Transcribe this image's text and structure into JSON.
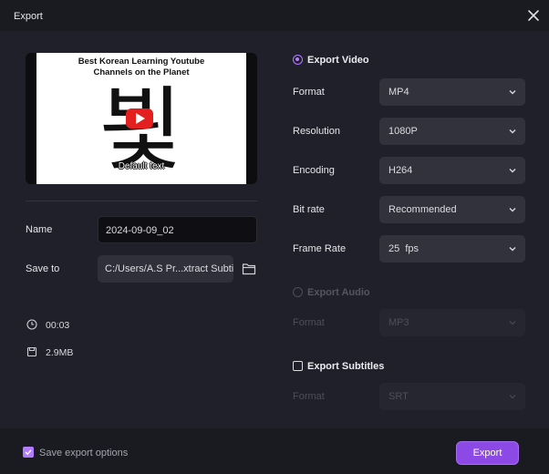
{
  "window": {
    "title": "Export"
  },
  "preview": {
    "thumbnail_title_line1": "Best Korean Learning Youtube",
    "thumbnail_title_line2": "Channels on the Planet",
    "thumbnail_character": "뵟",
    "subtitle_text": "Default text"
  },
  "left": {
    "name_label": "Name",
    "name_value": "2024-09-09_02",
    "save_to_label": "Save to",
    "save_to_value": "C:/Users/A.S Pr...xtract Subtitle",
    "duration": "00:03",
    "file_size": "2.9MB"
  },
  "export_video": {
    "label": "Export Video",
    "selected": true,
    "format_label": "Format",
    "format_value": "MP4",
    "resolution_label": "Resolution",
    "resolution_value": "1080P",
    "encoding_label": "Encoding",
    "encoding_value": "H264",
    "bitrate_label": "Bit rate",
    "bitrate_value": "Recommended",
    "framerate_label": "Frame Rate",
    "framerate_value": "25  fps"
  },
  "export_audio": {
    "label": "Export Audio",
    "selected": false,
    "format_label": "Format",
    "format_value": "MP3"
  },
  "export_subtitles": {
    "label": "Export Subtitles",
    "checked": false,
    "format_label": "Format",
    "format_value": "SRT"
  },
  "footer": {
    "save_options_label": "Save export options",
    "save_options_checked": true,
    "export_button": "Export"
  },
  "colors": {
    "accent": "#b57bff",
    "button": "#8c49e6",
    "background": "#20202a",
    "titlebar": "#1a1a21"
  },
  "icons": [
    "close-icon",
    "folder-icon",
    "clock-icon",
    "file-size-icon",
    "chevron-down-icon",
    "play-icon",
    "check-icon"
  ]
}
